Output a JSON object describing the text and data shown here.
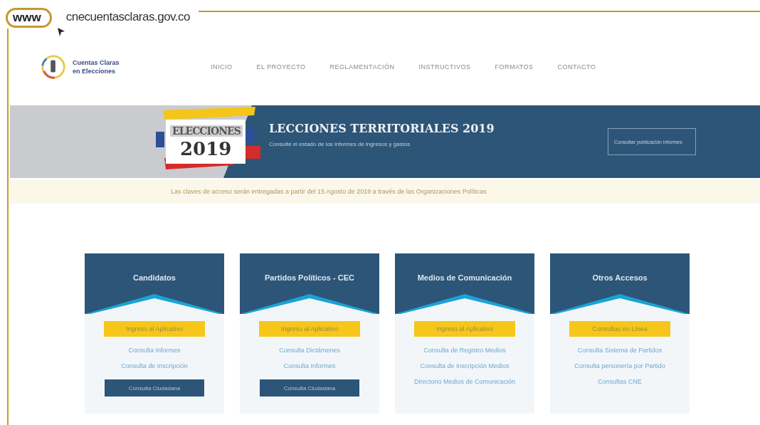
{
  "frame": {
    "badge": "www",
    "url": "cnecuentasclaras.gov.co"
  },
  "site": {
    "logo": {
      "line1": "Cuentas Claras",
      "line2": "en Elecciones"
    },
    "nav": [
      {
        "label": "INICIO"
      },
      {
        "label": "EL PROYECTO"
      },
      {
        "label": "REGLAMENTACIÓN"
      },
      {
        "label": "INSTRUCTIVOS"
      },
      {
        "label": "FORMATOS"
      },
      {
        "label": "CONTACTO"
      }
    ],
    "banner": {
      "badge_top": "ELECCIONES",
      "badge_year": "2019",
      "title": "LECCIONES TERRITORIALES 2019",
      "subtitle": "Consulte el estado de los informes de ingresos y gastos",
      "button": "Consultar publicación informes"
    },
    "notice": "Las claves de acceso serán entregadas a partir del 15 Agosto de 2019 a través de las Organizaciones Políticas",
    "cards": [
      {
        "title": "Candidatos",
        "action": "Ingreso al Aplicativo",
        "links": [
          "Consulta Informes",
          "Consulta de Inscripción"
        ],
        "button": "Consulta Ciudadana"
      },
      {
        "title": "Partidos Políticos - CEC",
        "action": "Ingreso al Aplicativo",
        "links": [
          "Consulta Dictámenes",
          "Consulta Informes"
        ],
        "button": "Consulta Ciudadana"
      },
      {
        "title": "Medios de Comunicación",
        "action": "Ingreso al Aplicativo",
        "links": [
          "Consulta de Registro Medios",
          "Consulta de Inscripción Medios",
          "Directorio Medios de Comunicación"
        ]
      },
      {
        "title": "Otros Accesos",
        "action": "Consultas en Línea",
        "links": [
          "Consulta Sistema de Partidos",
          "Consulta personería por Partido",
          "Consultas CNE"
        ]
      }
    ]
  }
}
